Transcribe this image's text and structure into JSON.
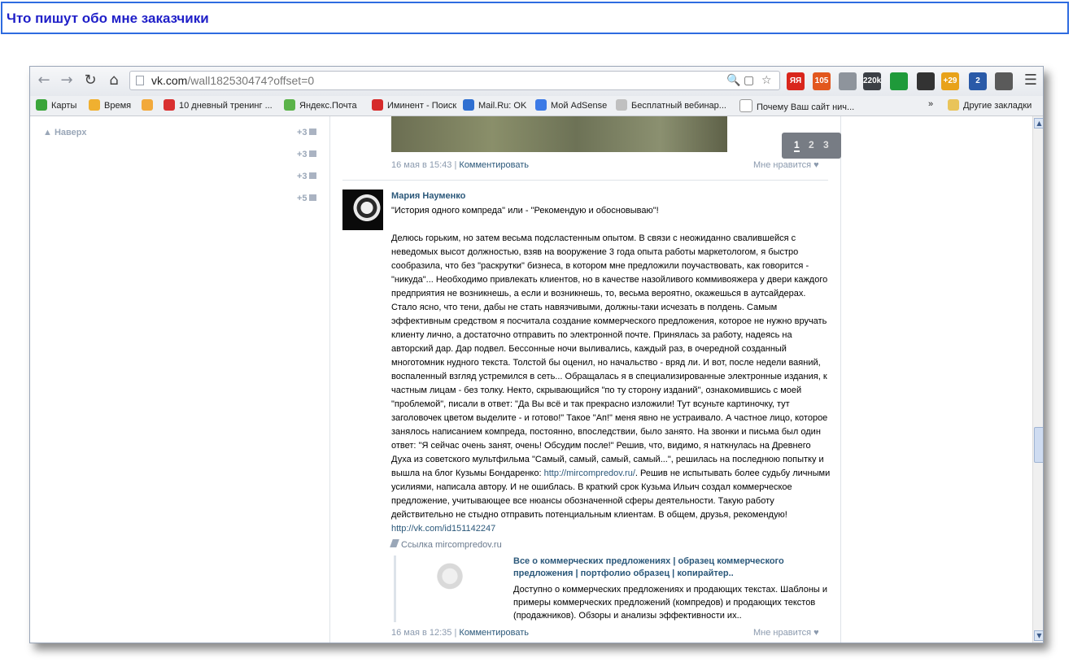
{
  "page": {
    "heading": "Что пишут обо мне заказчики"
  },
  "browser": {
    "url_host": "vk.com",
    "url_path": "/wall182530474?offset=0",
    "extensions": [
      {
        "icon": "yandex-icon",
        "text": "ЯЯ",
        "color": "#d9261c"
      },
      {
        "icon": "inbox-icon",
        "text": "105",
        "color": "#e2571e"
      },
      {
        "icon": "trash-icon",
        "text": "",
        "color": "#8e949c"
      },
      {
        "icon": "counter-icon",
        "text": "220k",
        "color": "#3b3f45"
      },
      {
        "icon": "robot-icon",
        "text": "",
        "color": "#1f9a3a"
      },
      {
        "icon": "binoculars-icon",
        "text": "",
        "color": "#333333"
      },
      {
        "icon": "weather-icon",
        "text": "+29",
        "color": "#e8a21a"
      },
      {
        "icon": "window-icon",
        "text": "2",
        "color": "#2a5aa8"
      },
      {
        "icon": "evernote-icon",
        "text": "",
        "color": "#5a5a5a"
      }
    ]
  },
  "bookmarks": [
    {
      "label": "Карты",
      "color": "#3aa53a"
    },
    {
      "label": "Время",
      "color": "#f0b030"
    },
    {
      "label": "",
      "color": "#f2a93b"
    },
    {
      "label": "10 дневный тренинг ...",
      "color": "#d93030"
    },
    {
      "label": "Яндекс.Почта",
      "color": "#5bb34a"
    },
    {
      "label": "Иминент - Поиск",
      "color": "#d62b2b"
    },
    {
      "label": "Mail.Ru: OK",
      "color": "#2f6fd1"
    },
    {
      "label": "Мой AdSense",
      "color": "#3c7ae6"
    },
    {
      "label": "Бесплатный вебинар...",
      "color": "#c0c0c0"
    },
    {
      "label": "Почему Ваш сайт нич...",
      "color": "#ffffff"
    }
  ],
  "bookmarks_more": "»",
  "other_bookmarks": "Другие закладки",
  "sidebar": {
    "up_label": "Наверх",
    "counters": [
      "+3",
      "+3",
      "+3",
      "+5"
    ]
  },
  "pager": [
    "1",
    "2",
    "3"
  ],
  "prev_post": {
    "date": "16 мая в 15:43",
    "divider": "|",
    "comment": "Комментировать",
    "like": "Мне нравится"
  },
  "post": {
    "author": "Мария Науменко",
    "text_intro": "\"История одного компреда\" или - \"Рекомендую и обосновываю\"!\n\nДелюсь горьким, но затем весьма подсластенным опытом. В связи с неожиданно свалившейся с неведомых высот должностью, взяв на вооружение 3 года опыта работы маркетологом, я быстро сообразила, что без \"раскрутки\" бизнеса, в котором мне предложили поучаствовать, как говорится - \"никуда\"... Необходимо привлекать клиентов, но в качестве назойливого коммивояжера у двери каждого предприятия не возникнешь, а если и возникнешь, то, весьма вероятно, окажешься в аутсайдерах. Стало ясно, что тени, дабы не стать навязчивыми, должны-таки исчезать в полдень. Самым эффективным средством я посчитала создание коммерческого предложения, которое не нужно вручать клиенту лично, а достаточно отправить по электронной почте. Принялась за работу, надеясь на авторский дар. Дар подвел. Бессонные ночи выливались, каждый раз, в очередной созданный многотомник нудного текста. Толстой бы оценил, но начальство - вряд ли. И вот, после недели ваяний, воспаленный взгляд устремился в сеть... Обращалась я в специализированные электронные издания, к частным лицам - без толку. Некто, скрывающийся \"по ту сторону изданий\", ознакомившись с моей \"проблемой\", писали в ответ: \"Да Вы всё и так прекрасно изложили! Тут всуньте картиночку, тут заголовочек цветом выделите - и готово!\" Такое \"Ап!\" меня явно не устраивало. А частное лицо, которое занялось написанием компреда, постоянно, впоследствии, было занято. На звонки и письма был один ответ: \"Я сейчас очень занят, очень! Обсудим после!\" Решив, что, видимо, я наткнулась на Древнего Духа из советского мультфильма \"Самый, самый, самый, самый...\", решилась на последнюю попытку и вышла на блог Кузьмы Бондаренко: ",
    "link1": "http://mircompredov.ru/",
    "text_outro": ". Решив не испытывать более судьбу личными усилиями, написала автору. И не ошиблась. В краткий срок Кузьма Ильич создал коммерческое предложение, учитывающее все нюансы обозначенной сферы деятельности. Такую работу действительно не стыдно отправить потенциальным клиентам. В общем, друзья, рекомендую!\n",
    "link2": "http://vk.com/id151142247",
    "link_label": "Ссылка mircompredov.ru",
    "card_title": "Все о коммерческих предложениях | образец коммерческого предложения | портфолио образец | копирайтер..",
    "card_desc": "Доступно о коммерческих предложениях и продающих текстах. Шаблоны и примеры коммерческих предложений (компредов) и продающих текстов (продажников). Обзоры и анализы эффективности их..",
    "date": "16 мая в 12:35",
    "divider": "|",
    "comment": "Комментировать",
    "like": "Мне нравится"
  }
}
